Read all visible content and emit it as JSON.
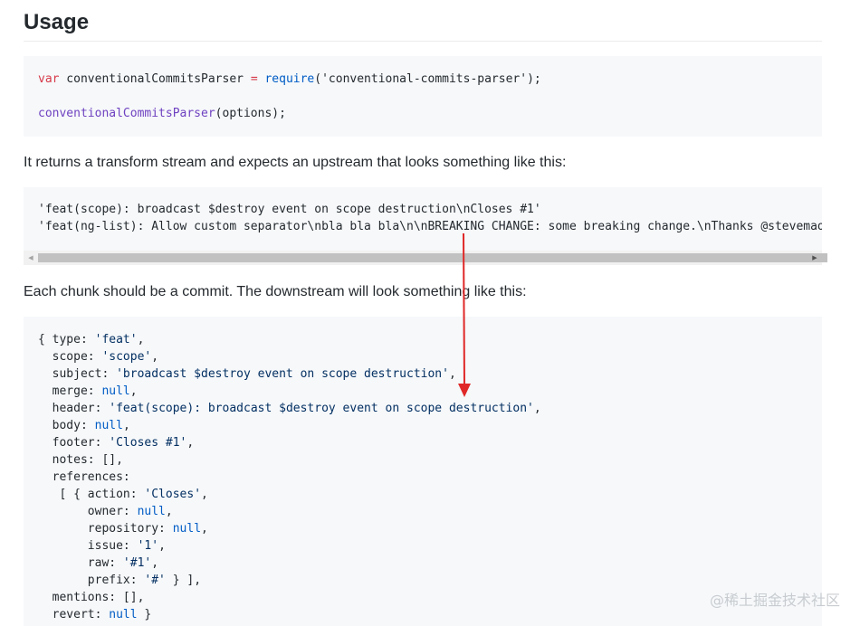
{
  "heading": "Usage",
  "code1": {
    "line1": {
      "kw": "var",
      "ident": " conventionalCommitsParser ",
      "eq": "=",
      "fn": " require",
      "rest": "('conventional-commits-parser');"
    },
    "line3": {
      "fn": "conventionalCommitsParser",
      "rest": "(options);"
    }
  },
  "para1": "It returns a transform stream and expects an upstream that looks something like this:",
  "code2": {
    "lines": [
      "'feat(scope): broadcast $destroy event on scope destruction\\nCloses #1'",
      "'feat(ng-list): Allow custom separator\\nbla bla bla\\n\\nBREAKING CHANGE: some breaking change.\\nThanks @stevemao\\n'"
    ]
  },
  "para2": "Each chunk should be a commit. The downstream will look something like this:",
  "code3": {
    "l1": {
      "a": "{ type: ",
      "b": "'feat'",
      "c": ","
    },
    "l2": {
      "a": "  scope: ",
      "b": "'scope'",
      "c": ","
    },
    "l3": {
      "a": "  subject: ",
      "b": "'broadcast $destroy event on scope destruction'",
      "c": ","
    },
    "l4": {
      "a": "  merge: ",
      "b": "null",
      "c": ","
    },
    "l5": {
      "a": "  header: ",
      "b": "'feat(scope): broadcast $destroy event on scope destruction'",
      "c": ","
    },
    "l6": {
      "a": "  body: ",
      "b": "null",
      "c": ","
    },
    "l7": {
      "a": "  footer: ",
      "b": "'Closes #1'",
      "c": ","
    },
    "l8": {
      "a": "  notes: [],"
    },
    "l9": {
      "a": "  references:"
    },
    "l10": {
      "a": "   [ { action: ",
      "b": "'Closes'",
      "c": ","
    },
    "l11": {
      "a": "       owner: ",
      "b": "null",
      "c": ","
    },
    "l12": {
      "a": "       repository: ",
      "b": "null",
      "c": ","
    },
    "l13": {
      "a": "       issue: ",
      "b": "'1'",
      "c": ","
    },
    "l14": {
      "a": "       raw: ",
      "b": "'#1'",
      "c": ","
    },
    "l15": {
      "a": "       prefix: ",
      "b": "'#'",
      "c": " } ],"
    },
    "l16": {
      "a": "  mentions: [],"
    },
    "l17": {
      "a": "  revert: ",
      "b": "null",
      "c": " }"
    }
  },
  "watermark": "@稀土掘金技术社区",
  "colors": {
    "keyword": "#d73a49",
    "function": "#6f42c1",
    "string": "#032f62",
    "literal": "#005cc5",
    "annotation_arrow": "#e02828"
  },
  "icons": {
    "scroll_left": "triangle-left",
    "scroll_right": "triangle-right"
  }
}
